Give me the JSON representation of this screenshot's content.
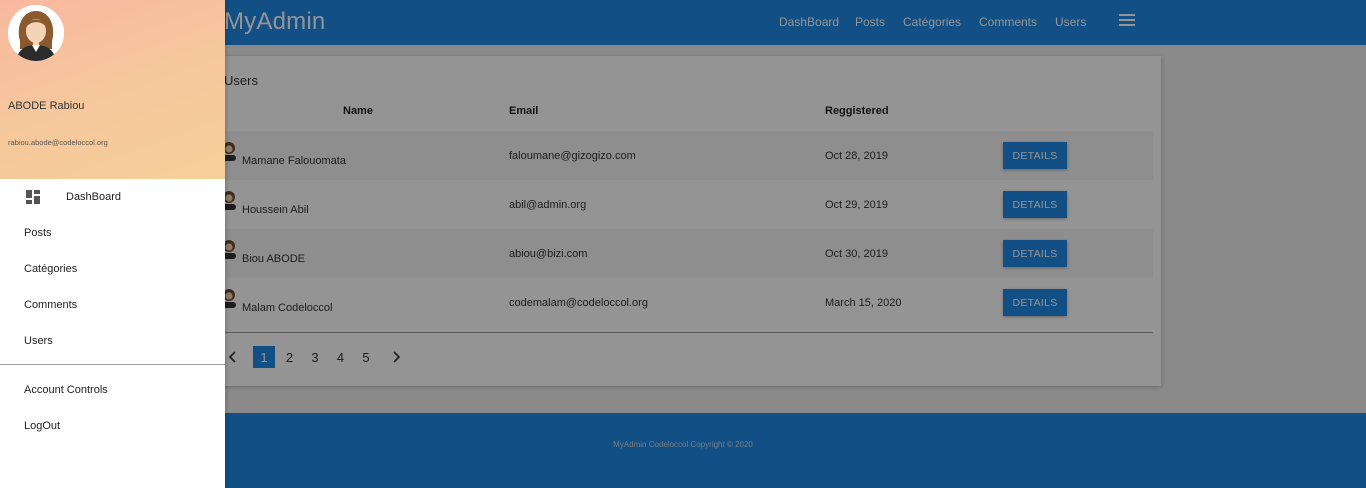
{
  "brand": "MyAdmin",
  "nav": {
    "items": [
      "DashBoard",
      "Posts",
      "Catégories",
      "Comments",
      "Users"
    ]
  },
  "card": {
    "title": "Users",
    "headers": {
      "name": "Name",
      "email": "Email",
      "registered": "Reggistered"
    },
    "rows": [
      {
        "name": "Mamane Falouomata",
        "email": "faloumane@gizogizo.com",
        "registered": "Oct 28, 2019",
        "action": "DETAILS"
      },
      {
        "name": "Houssein Abil",
        "email": "abil@admin.org",
        "registered": "Oct 29, 2019",
        "action": "DETAILS"
      },
      {
        "name": "Biou ABODE",
        "email": "abiou@bizi.com",
        "registered": "Oct 30, 2019",
        "action": "DETAILS"
      },
      {
        "name": "Malam Codeloccol",
        "email": "codemalam@codeloccol.org",
        "registered": "March 15, 2020",
        "action": "DETAILS"
      }
    ],
    "pagination": {
      "pages": [
        "1",
        "2",
        "3",
        "4",
        "5"
      ],
      "current": "1"
    }
  },
  "footer": {
    "text": "MyAdmin Codeloccol Copyright © 2020"
  },
  "drawer": {
    "user_name": "ABODE Rabiou",
    "user_email": "rabiou.abode@codeloccol.org",
    "items": [
      "DashBoard",
      "Posts",
      "Catégories",
      "Comments",
      "Users"
    ],
    "secondary": [
      "Account Controls",
      "LogOut"
    ]
  },
  "colors": {
    "primary": "#1e88e5",
    "drawer_header_start": "#f8b8a0",
    "drawer_header_end": "#f5cf98"
  },
  "icons": {
    "menu": "hamburger-icon",
    "dashboard": "dashboard-grid-icon",
    "prev": "chevron-left-icon",
    "next": "chevron-right-icon"
  }
}
